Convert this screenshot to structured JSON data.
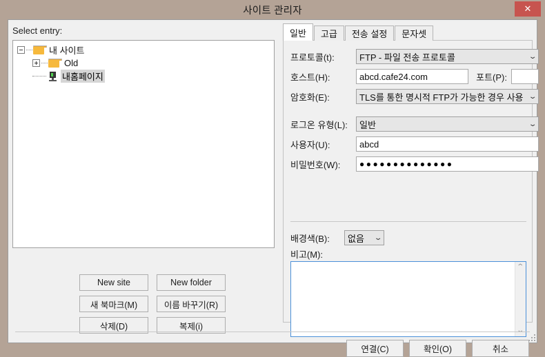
{
  "window": {
    "title": "사이트 관리자",
    "close_label": "✕"
  },
  "left": {
    "select_entry_label": "Select entry:",
    "tree": [
      {
        "label": "내 사이트",
        "depth": 0,
        "icon": "folder-icon",
        "expander": "minus",
        "selected": false
      },
      {
        "label": "Old",
        "depth": 1,
        "icon": "folder-icon",
        "expander": "plus",
        "selected": false
      },
      {
        "label": "내홈페이지",
        "depth": 1,
        "icon": "server-icon",
        "expander": "none",
        "selected": true
      }
    ],
    "buttons": [
      {
        "label": "New site"
      },
      {
        "label": "New folder"
      },
      {
        "label": "새 북마크(M)"
      },
      {
        "label": "이름 바꾸기(R)"
      },
      {
        "label": "삭제(D)"
      },
      {
        "label": "복제(i)"
      }
    ]
  },
  "right": {
    "tabs": [
      {
        "label": "일반",
        "active": true
      },
      {
        "label": "고급",
        "active": false
      },
      {
        "label": "전송 설정",
        "active": false
      },
      {
        "label": "문자셋",
        "active": false
      }
    ],
    "protocol": {
      "label": "프로토콜(t):",
      "value": "FTP - 파일 전송 프로토콜"
    },
    "host": {
      "label": "호스트(H):",
      "value": "abcd.cafe24.com"
    },
    "port": {
      "label": "포트(P):",
      "value": ""
    },
    "encryption": {
      "label": "암호화(E):",
      "value": "TLS를 통한 명시적 FTP가 가능한 경우 사용"
    },
    "logon_type": {
      "label": "로그온 유형(L):",
      "value": "일반"
    },
    "user": {
      "label": "사용자(U):",
      "value": "abcd"
    },
    "password": {
      "label": "비밀번호(W):",
      "value": "●●●●●●●●●●●●●●"
    },
    "background_color": {
      "label": "배경색(B):",
      "value": "없음"
    },
    "comments": {
      "label": "비고(M):",
      "value": ""
    },
    "chevron": "⌄",
    "scroll_up": "⌃",
    "scroll_down": "⌄"
  },
  "bottom": {
    "buttons": [
      {
        "label": "연결(C)"
      },
      {
        "label": "확인(O)"
      },
      {
        "label": "취소"
      }
    ]
  }
}
